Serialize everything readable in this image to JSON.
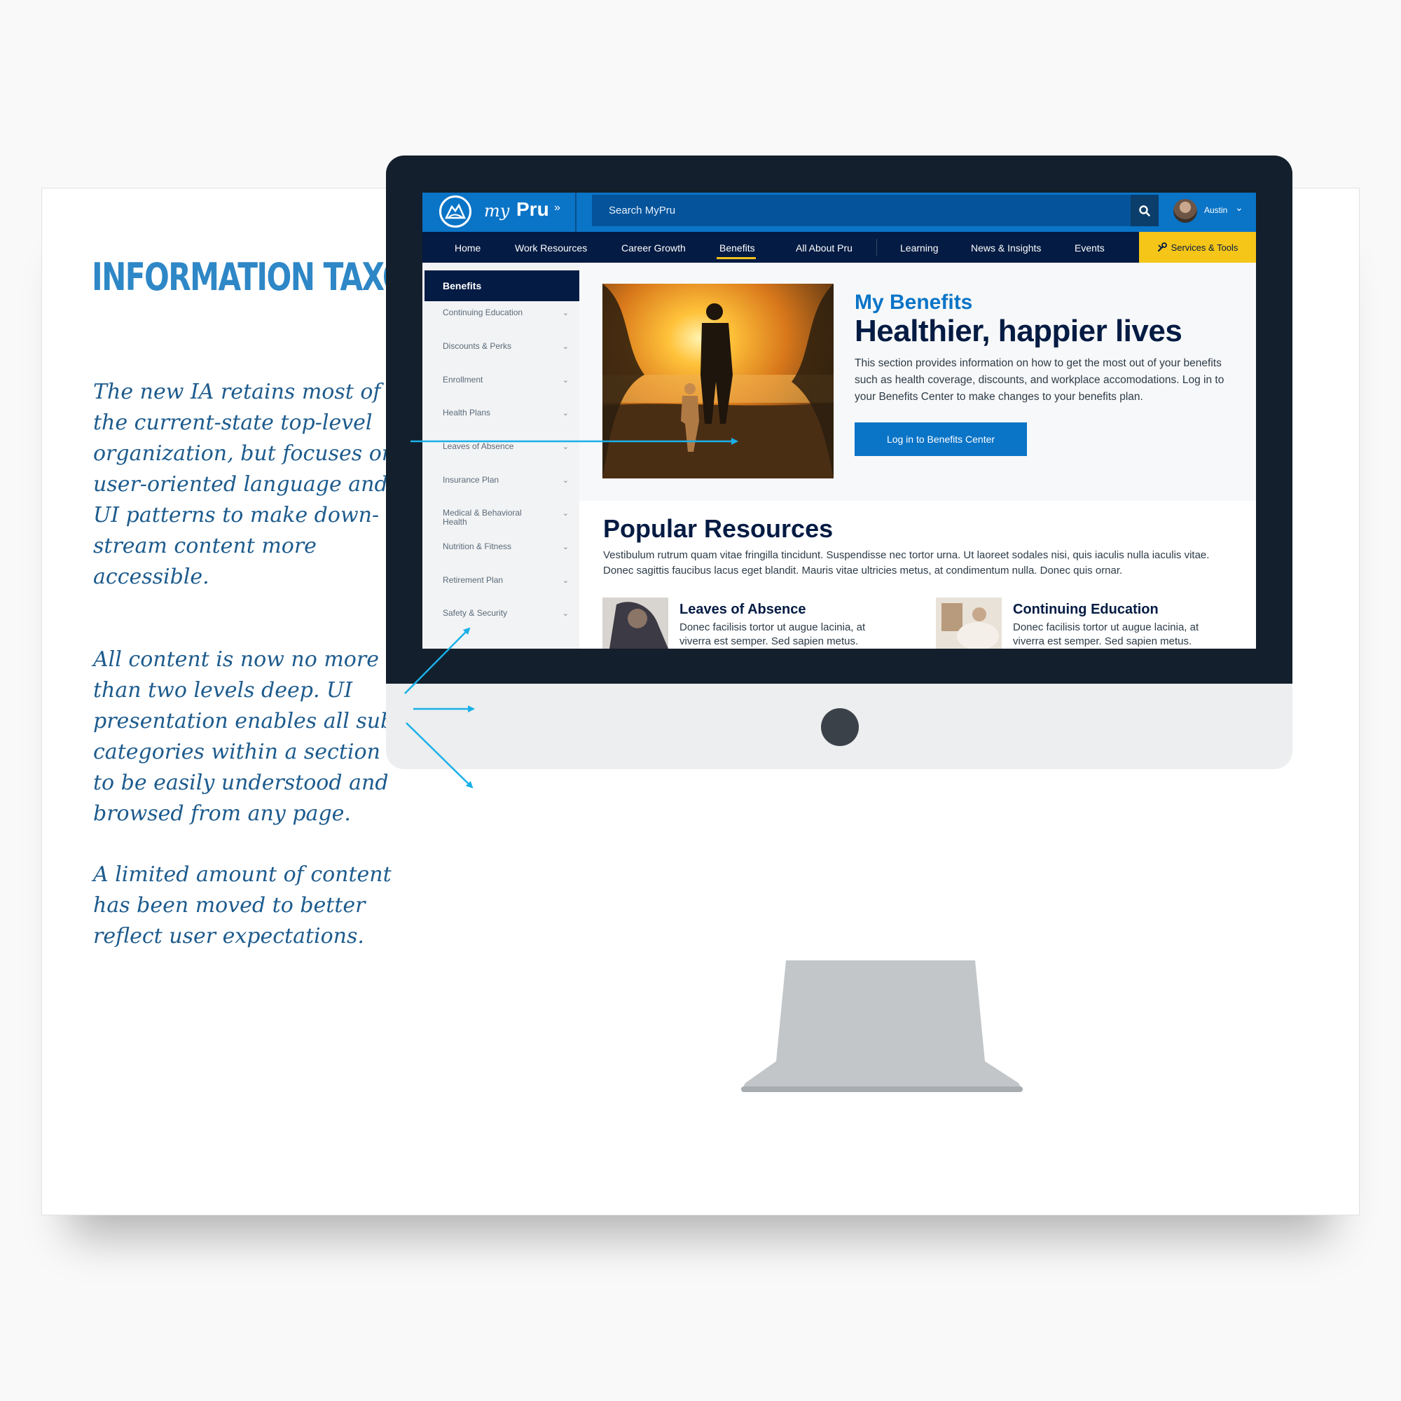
{
  "slide": {
    "title": "INFORMATION TAXONOMY",
    "notes": [
      "The new IA retains most of the current-state top-level organization, but focuses on user-oriented language and UI patterns to make down-stream content more accessible.",
      "All content is now no more than two levels deep. UI presentation enables all sub-categories within a section to be easily understood and browsed from any page.",
      "A limited amount of content has been moved to better reflect user expectations."
    ],
    "accent_color": "#2e87c6",
    "note_color": "#1d5b8d",
    "arrow_color": "#1ab0e8"
  },
  "app": {
    "brand_prefix": "my",
    "brand_name": "Pru",
    "search_placeholder": "Search MyPru",
    "user_name": "Austin",
    "nav": [
      "Home",
      "Work Resources",
      "Career Growth",
      "Benefits",
      "All About Pru",
      "Learning",
      "News & Insights",
      "Events"
    ],
    "active_nav": "Benefits",
    "services_label": "Services & Tools",
    "sidebar": {
      "heading": "Benefits",
      "items": [
        "Continuing Education",
        "Discounts & Perks",
        "Enrollment",
        "Health Plans",
        "Leaves of Absence",
        "Insurance Plan",
        "Medical & Behavioral Health",
        "Nutrition & Fitness",
        "Retirement Plan",
        "Safety & Security"
      ]
    },
    "hero": {
      "kicker": "My Benefits",
      "headline": "Healthier, happier lives",
      "body": "This section provides information on how to get the most out of your benefits such as health coverage, discounts, and workplace accomodations. Log in to your Benefits Center to make changes to your benefits plan.",
      "cta": "Log in to Benefits Center"
    },
    "popular": {
      "title": "Popular Resources",
      "body": "Vestibulum rutrum quam vitae fringilla tincidunt. Suspendisse nec tortor urna. Ut laoreet sodales nisi, quis iaculis nulla iaculis vitae. Donec sagittis faucibus lacus eget blandit. Mauris vitae ultricies metus, at condimentum nulla. Donec quis ornar.",
      "cards": [
        {
          "title": "Leaves of Absence",
          "text": "Donec facilisis tortor ut augue lacinia, at viverra est semper. Sed sapien metus."
        },
        {
          "title": "Continuing Education",
          "text": "Donec facilisis tortor ut augue lacinia, at viverra est semper. Sed sapien metus."
        }
      ]
    },
    "colors": {
      "primary_blue": "#0a74c7",
      "navy": "#041b43",
      "yellow": "#f5c518"
    },
    "icons": {
      "logo": "rock-of-gibraltar-logo",
      "search": "search-icon",
      "services": "tools-icon",
      "chevron": "chevron-down-icon"
    }
  }
}
